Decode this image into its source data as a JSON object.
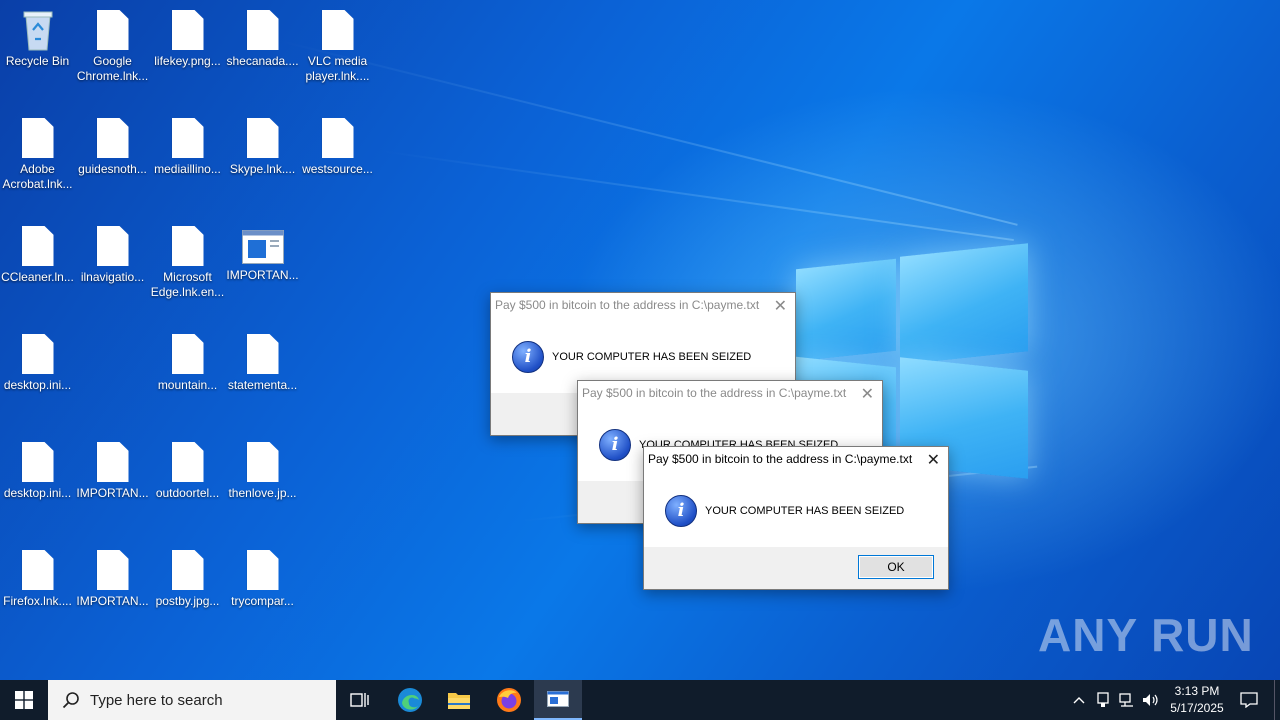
{
  "desktop": {
    "icons": [
      {
        "label": "Recycle Bin",
        "type": "recycle"
      },
      {
        "label": "Google\nChrome.lnk...",
        "type": "file"
      },
      {
        "label": "lifekey.png...",
        "type": "file"
      },
      {
        "label": "shecanada....",
        "type": "file"
      },
      {
        "label": "VLC media\nplayer.lnk....",
        "type": "file"
      },
      {
        "label": "Adobe\nAcrobat.lnk...",
        "type": "file"
      },
      {
        "label": "guidesnoth...",
        "type": "file"
      },
      {
        "label": "mediaillino...",
        "type": "file"
      },
      {
        "label": "Skype.lnk....",
        "type": "file"
      },
      {
        "label": "westsource...",
        "type": "file"
      },
      {
        "label": "CCleaner.ln...",
        "type": "file"
      },
      {
        "label": "ilnavigatio...",
        "type": "file"
      },
      {
        "label": "Microsoft\nEdge.lnk.en...",
        "type": "file"
      },
      {
        "label": "IMPORTAN...",
        "type": "app"
      },
      {
        "label": "desktop.ini...",
        "type": "file"
      },
      {
        "label": "mountain...",
        "type": "file"
      },
      {
        "label": "statementa...",
        "type": "file"
      },
      {
        "label": "desktop.ini...",
        "type": "file"
      },
      {
        "label": "IMPORTAN...",
        "type": "file"
      },
      {
        "label": "outdoortel...",
        "type": "file"
      },
      {
        "label": "thenlove.jp...",
        "type": "file"
      },
      {
        "label": "Firefox.lnk....",
        "type": "file"
      },
      {
        "label": "IMPORTAN...",
        "type": "file"
      },
      {
        "label": "postby.jpg...",
        "type": "file"
      },
      {
        "label": "trycompar...",
        "type": "file"
      }
    ]
  },
  "dialogs": [
    {
      "title": "Pay $500 in bitcoin to the address in C:\\payme.txt",
      "message": "YOUR COMPUTER HAS BEEN SEIZED",
      "close": "✕"
    },
    {
      "title": "Pay $500 in bitcoin to the address in C:\\payme.txt",
      "message": "YOUR COMPUTER HAS BEEN SEIZED",
      "close": "✕"
    },
    {
      "title": "Pay $500 in bitcoin to the address in C:\\payme.txt",
      "message": "YOUR COMPUTER HAS BEEN SEIZED",
      "close": "✕",
      "ok_label": "OK"
    }
  ],
  "taskbar": {
    "search_placeholder": "Type here to search",
    "time": "3:13 PM",
    "date": "5/17/2025",
    "pinned": [
      "task-view-icon",
      "edge-icon",
      "file-explorer-icon",
      "firefox-icon",
      "message-box-app-icon"
    ],
    "tray": [
      "chevron-up-icon",
      "device-icon",
      "network-icon",
      "volume-icon",
      "notifications-icon"
    ]
  },
  "watermark": "ANY RUN",
  "colors": {
    "taskbar": "#101c2b",
    "accent": "#0078d7",
    "desktop": "#0a5fd0"
  }
}
